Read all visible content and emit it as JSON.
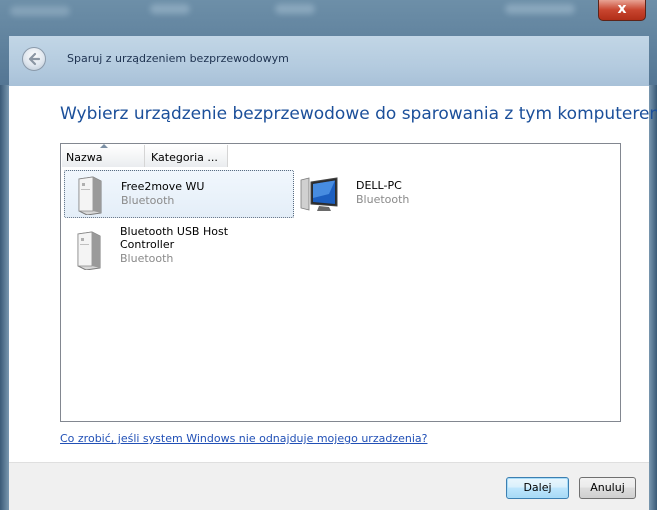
{
  "window": {
    "title": "Sparuj z urządzeniem bezprzewodowym",
    "close_label": "x"
  },
  "main": {
    "heading": "Wybierz urządzenie bezprzewodowe do sparowania z tym komputerem"
  },
  "listview": {
    "columns": [
      "Nazwa",
      "Kategoria ..."
    ],
    "sort_column": "Nazwa",
    "items": [
      {
        "name": "Free2move WU",
        "category": "Bluetooth",
        "icon": "device-tower-icon",
        "selected": true
      },
      {
        "name": "DELL-PC",
        "category": "Bluetooth",
        "icon": "computer-monitor-icon",
        "selected": false
      },
      {
        "name_line1": "Bluetooth USB Host",
        "name_line2": "Controller",
        "category": "Bluetooth",
        "icon": "device-tower-icon",
        "selected": false
      }
    ]
  },
  "help_link": "Co zrobić, jeśli system Windows nie odnajduje mojego urzadzenia?",
  "buttons": {
    "next": "Dalej",
    "cancel": "Anuluj"
  },
  "colors": {
    "heading": "#1b4f9a",
    "link": "#2150b6",
    "selection": "#e4eef8",
    "close_button": "#c8452f"
  }
}
